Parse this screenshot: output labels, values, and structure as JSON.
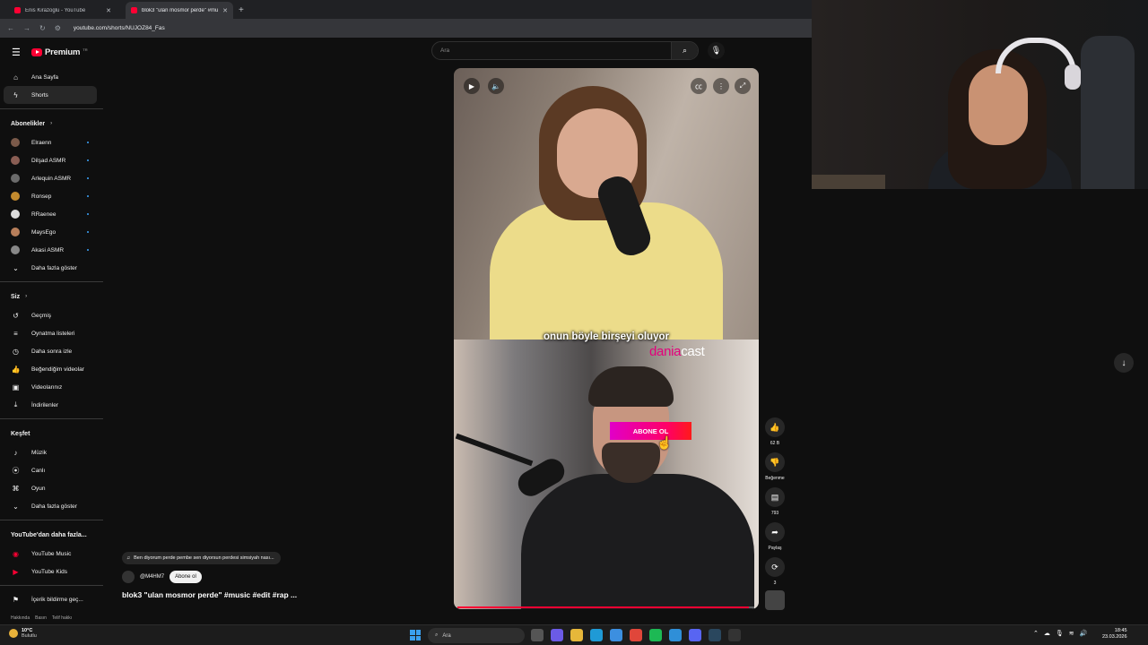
{
  "browser": {
    "tabs": [
      {
        "title": "Enis Kirazoglu - YouTube",
        "active": false
      },
      {
        "title": "blok3 \"ulan mosmor perde\" #mus",
        "active": true
      }
    ],
    "new_tab_icon": "plus-icon",
    "url": "youtube.com/shorts/NUJOZ84_Fas"
  },
  "header": {
    "logo_text": "Premium",
    "logo_badge": "TR",
    "search_placeholder": "Ara"
  },
  "sidebar": {
    "main": [
      {
        "label": "Ana Sayfa",
        "icon": "home-icon",
        "active": false
      },
      {
        "label": "Shorts",
        "icon": "shorts-icon",
        "active": true
      }
    ],
    "subscriptions_title": "Abonelikler",
    "subscriptions": [
      {
        "label": "Elraenn",
        "color": "#7b5a4a"
      },
      {
        "label": "Dilşad ASMR",
        "color": "#8a5e54"
      },
      {
        "label": "Arlequin ASMR",
        "color": "#6b6b6b"
      },
      {
        "label": "Ronsep",
        "color": "#c28a2e"
      },
      {
        "label": "RRaenee",
        "color": "#dddddd"
      },
      {
        "label": "MaysEgo",
        "color": "#b77e5a"
      },
      {
        "label": "Akasi ASMR",
        "color": "#888888"
      }
    ],
    "show_more": "Daha fazla göster",
    "you_title": "Siz",
    "you": [
      {
        "label": "Geçmiş",
        "icon": "history-icon"
      },
      {
        "label": "Oynatma listeleri",
        "icon": "playlist-icon"
      },
      {
        "label": "Daha sonra izle",
        "icon": "clock-icon"
      },
      {
        "label": "Beğendiğim videolar",
        "icon": "thumb-up-icon"
      },
      {
        "label": "Videolarınız",
        "icon": "video-icon"
      },
      {
        "label": "İndirilenler",
        "icon": "download-icon"
      }
    ],
    "explore_title": "Keşfet",
    "explore": [
      {
        "label": "Müzik",
        "icon": "music-icon"
      },
      {
        "label": "Canlı",
        "icon": "live-icon"
      },
      {
        "label": "Oyun",
        "icon": "gamepad-icon"
      },
      {
        "label": "Daha fazla göster",
        "icon": "chevron-down-icon"
      }
    ],
    "more_title": "YouTube'dan daha fazla...",
    "more": [
      {
        "label": "YouTube Music",
        "icon": "youtube-music-icon"
      },
      {
        "label": "YouTube Kids",
        "icon": "youtube-kids-icon"
      }
    ],
    "report": "İçerik bildirme geç...",
    "footer": [
      "Hakkında",
      "Basın",
      "Telif hakkı"
    ]
  },
  "video": {
    "subtitle": "onun böyle birşeyi oluyor",
    "brand_prefix": "dania",
    "brand_suffix": "cast",
    "subscribe_overlay": "ABONE OL",
    "progress": 0.98,
    "accent": "#ff0033"
  },
  "actions": {
    "likes": "62 B",
    "dislike_label": "Beğenme",
    "comments": "793",
    "share_label": "Paylaş",
    "remix_count": "3"
  },
  "meta": {
    "music_text": "Ben diyorum perde pembe  sen diyorsun perdesi simsiyah nası...",
    "channel": "@M4HM7",
    "subscribe": "Abone ol",
    "title": "blok3 \"ulan mosmor perde\" #music #edit #rap ..."
  },
  "taskbar": {
    "weather_temp": "10°C",
    "weather_desc": "Bulutlu",
    "search": "Ara",
    "time": "18:45",
    "date": "23.03.2026"
  }
}
